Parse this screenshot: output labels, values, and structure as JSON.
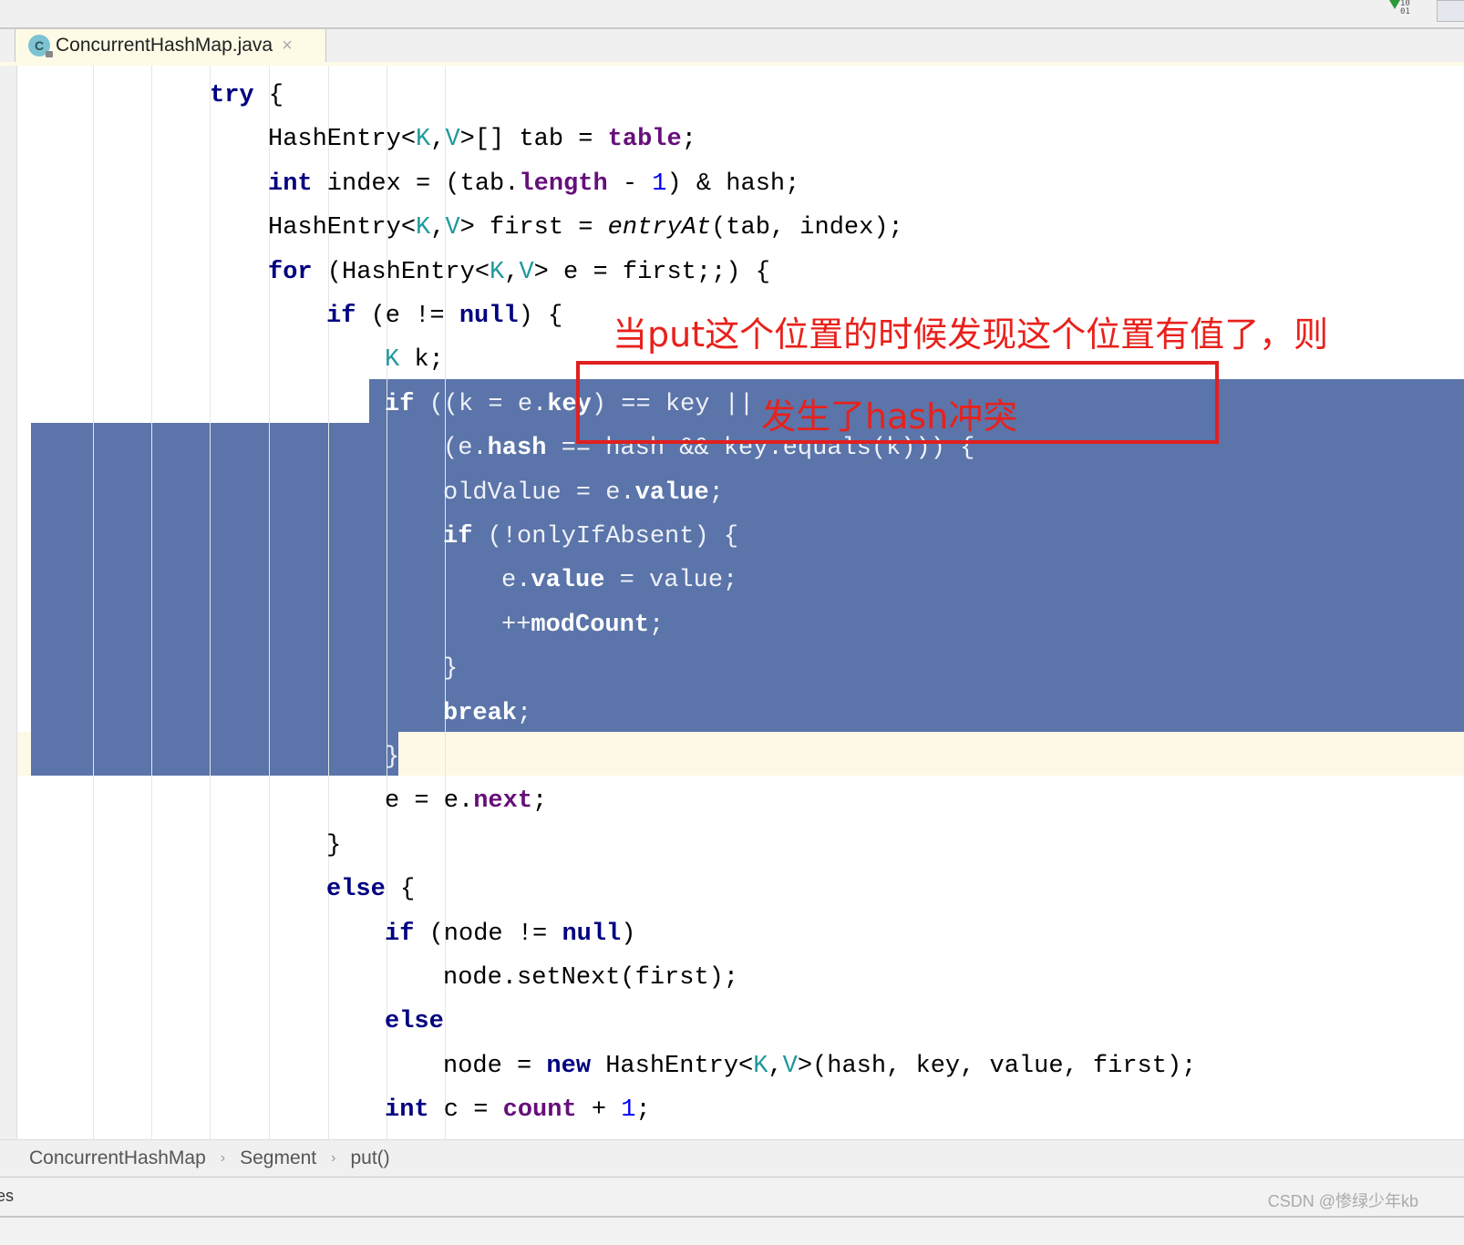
{
  "toolbar": {
    "vcs_icon": "vcs-update-icon",
    "vcs_digits_top": "10",
    "vcs_digits_bottom": "01"
  },
  "tab": {
    "icon_letter": "C",
    "filename": "ConcurrentHashMap.java",
    "close": "×"
  },
  "colors": {
    "selection": "#5b74a9",
    "keyword": "#000080",
    "field": "#660e7a",
    "type_param": "#20999d",
    "number": "#0000ff",
    "annotation": "#e8211c"
  },
  "code": [
    {
      "indent": 0,
      "tokens": [
        {
          "t": "try",
          "c": "kw"
        },
        {
          "t": " {",
          "c": ""
        }
      ]
    },
    {
      "indent": 1,
      "tokens": [
        {
          "t": "HashEntry<",
          "c": ""
        },
        {
          "t": "K",
          "c": "tp"
        },
        {
          "t": ",",
          "c": ""
        },
        {
          "t": "V",
          "c": "tp"
        },
        {
          "t": ">[] tab = ",
          "c": ""
        },
        {
          "t": "table",
          "c": "fld"
        },
        {
          "t": ";",
          "c": ""
        }
      ]
    },
    {
      "indent": 1,
      "tokens": [
        {
          "t": "int",
          "c": "kw"
        },
        {
          "t": " index = (tab.",
          "c": ""
        },
        {
          "t": "length",
          "c": "fld"
        },
        {
          "t": " - ",
          "c": ""
        },
        {
          "t": "1",
          "c": "num"
        },
        {
          "t": ") & hash;",
          "c": ""
        }
      ]
    },
    {
      "indent": 1,
      "tokens": [
        {
          "t": "HashEntry<",
          "c": ""
        },
        {
          "t": "K",
          "c": "tp"
        },
        {
          "t": ",",
          "c": ""
        },
        {
          "t": "V",
          "c": "tp"
        },
        {
          "t": "> first = ",
          "c": ""
        },
        {
          "t": "entryAt",
          "c": "it"
        },
        {
          "t": "(tab, index);",
          "c": ""
        }
      ]
    },
    {
      "indent": 1,
      "tokens": [
        {
          "t": "for",
          "c": "kw"
        },
        {
          "t": " (HashEntry<",
          "c": ""
        },
        {
          "t": "K",
          "c": "tp"
        },
        {
          "t": ",",
          "c": ""
        },
        {
          "t": "V",
          "c": "tp"
        },
        {
          "t": "> e = first;;) {",
          "c": ""
        }
      ]
    },
    {
      "indent": 2,
      "tokens": [
        {
          "t": "if",
          "c": "kw"
        },
        {
          "t": " (e != ",
          "c": ""
        },
        {
          "t": "null",
          "c": "kw"
        },
        {
          "t": ") {",
          "c": ""
        }
      ]
    },
    {
      "indent": 3,
      "tokens": [
        {
          "t": "K",
          "c": "tp"
        },
        {
          "t": " k;",
          "c": ""
        }
      ]
    },
    {
      "indent": 3,
      "sel": true,
      "tokens": [
        {
          "t": "if",
          "c": "kw"
        },
        {
          "t": " ((k = e.",
          "c": ""
        },
        {
          "t": "key",
          "c": "fld"
        },
        {
          "t": ") == key ||",
          "c": ""
        }
      ]
    },
    {
      "indent": 4,
      "sel": true,
      "tokens": [
        {
          "t": "(e.",
          "c": ""
        },
        {
          "t": "hash",
          "c": "fld"
        },
        {
          "t": " == hash && key.equals(k))) {",
          "c": ""
        }
      ]
    },
    {
      "indent": 4,
      "sel": true,
      "tokens": [
        {
          "t": "oldValue = e.",
          "c": ""
        },
        {
          "t": "value",
          "c": "fld"
        },
        {
          "t": ";",
          "c": ""
        }
      ]
    },
    {
      "indent": 4,
      "sel": true,
      "tokens": [
        {
          "t": "if",
          "c": "kw"
        },
        {
          "t": " (!onlyIfAbsent) {",
          "c": ""
        }
      ]
    },
    {
      "indent": 5,
      "sel": true,
      "tokens": [
        {
          "t": "e.",
          "c": ""
        },
        {
          "t": "value",
          "c": "fld"
        },
        {
          "t": " = value;",
          "c": ""
        }
      ]
    },
    {
      "indent": 5,
      "sel": true,
      "tokens": [
        {
          "t": "++",
          "c": ""
        },
        {
          "t": "modCount",
          "c": "fld"
        },
        {
          "t": ";",
          "c": ""
        }
      ]
    },
    {
      "indent": 4,
      "sel": true,
      "tokens": [
        {
          "t": "}",
          "c": ""
        }
      ]
    },
    {
      "indent": 4,
      "sel": true,
      "tokens": [
        {
          "t": "break",
          "c": "kw"
        },
        {
          "t": ";",
          "c": ""
        }
      ]
    },
    {
      "indent": 3,
      "sel": true,
      "tokens": [
        {
          "t": "}",
          "c": ""
        }
      ]
    },
    {
      "indent": 3,
      "tokens": [
        {
          "t": "e = e.",
          "c": ""
        },
        {
          "t": "next",
          "c": "fld"
        },
        {
          "t": ";",
          "c": ""
        }
      ]
    },
    {
      "indent": 2,
      "tokens": [
        {
          "t": "}",
          "c": ""
        }
      ]
    },
    {
      "indent": 2,
      "tokens": [
        {
          "t": "else",
          "c": "kw"
        },
        {
          "t": " {",
          "c": ""
        }
      ]
    },
    {
      "indent": 3,
      "tokens": [
        {
          "t": "if",
          "c": "kw"
        },
        {
          "t": " (node != ",
          "c": ""
        },
        {
          "t": "null",
          "c": "kw"
        },
        {
          "t": ")",
          "c": ""
        }
      ]
    },
    {
      "indent": 4,
      "tokens": [
        {
          "t": "node.setNext(first);",
          "c": ""
        }
      ]
    },
    {
      "indent": 3,
      "tokens": [
        {
          "t": "else",
          "c": "kw"
        }
      ]
    },
    {
      "indent": 4,
      "tokens": [
        {
          "t": "node = ",
          "c": ""
        },
        {
          "t": "new",
          "c": "kw"
        },
        {
          "t": " HashEntry<",
          "c": ""
        },
        {
          "t": "K",
          "c": "tp"
        },
        {
          "t": ",",
          "c": ""
        },
        {
          "t": "V",
          "c": "tp"
        },
        {
          "t": ">(hash, key, value, first);",
          "c": ""
        }
      ]
    },
    {
      "indent": 3,
      "tokens": [
        {
          "t": "int",
          "c": "kw"
        },
        {
          "t": " c = ",
          "c": ""
        },
        {
          "t": "count",
          "c": "fld"
        },
        {
          "t": " + ",
          "c": ""
        },
        {
          "t": "1",
          "c": "num"
        },
        {
          "t": ";",
          "c": ""
        }
      ]
    }
  ],
  "annotations": {
    "box_text": "当put这个位置的时候发现这个位置有值了，则",
    "second_text": "发生了hash冲突"
  },
  "breadcrumb": [
    "ConcurrentHashMap",
    "Segment",
    "put()"
  ],
  "status": {
    "left_fragment": "es",
    "watermark": "CSDN @惨绿少年kb"
  }
}
